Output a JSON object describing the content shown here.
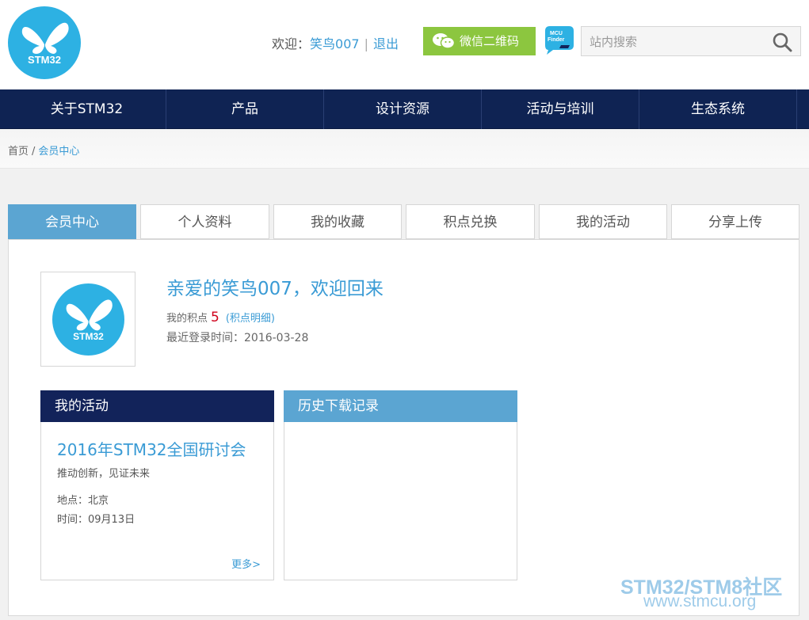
{
  "header": {
    "logo_text": "STM32",
    "welcome_prefix": "欢迎：",
    "username": "笑鸟007",
    "separator": "|",
    "logout": "退出",
    "wechat_label": "微信二维码",
    "mcu_finder_line1": "MCU",
    "mcu_finder_line2": "Finder",
    "search_placeholder": "站内搜索"
  },
  "nav": {
    "items": [
      {
        "label": "关于STM32"
      },
      {
        "label": "产品"
      },
      {
        "label": "设计资源"
      },
      {
        "label": "活动与培训"
      },
      {
        "label": "生态系统"
      }
    ]
  },
  "breadcrumb": {
    "home": "首页",
    "slash": "/",
    "current": "会员中心"
  },
  "tabs": [
    {
      "label": "会员中心",
      "active": true
    },
    {
      "label": "个人资料"
    },
    {
      "label": "我的收藏"
    },
    {
      "label": "积点兑换"
    },
    {
      "label": "我的活动"
    },
    {
      "label": "分享上传"
    }
  ],
  "profile": {
    "avatar_text": "STM32",
    "greeting": "亲爱的笑鸟007，欢迎回来",
    "points_label": "我的积点",
    "points_value": "5",
    "points_detail": "(积点明细)",
    "last_login": "最近登录时间：2016-03-28"
  },
  "activity_box": {
    "title": "我的活动",
    "event_title": "2016年STM32全国研讨会",
    "event_subtitle": "推动创新，见证未来",
    "event_place": "地点：北京",
    "event_time": "时间：09月13日",
    "more": "更多>"
  },
  "download_box": {
    "title": "历史下载记录"
  },
  "watermark": {
    "line1": "STM32/STM8社区",
    "line2": "www.stmcu.org"
  },
  "colors": {
    "brand_blue": "#2db1e3",
    "nav_dark": "#0f2353",
    "tab_active": "#5ba5d2",
    "wechat_green": "#8cc63f",
    "link_blue": "#3a9bd5"
  }
}
